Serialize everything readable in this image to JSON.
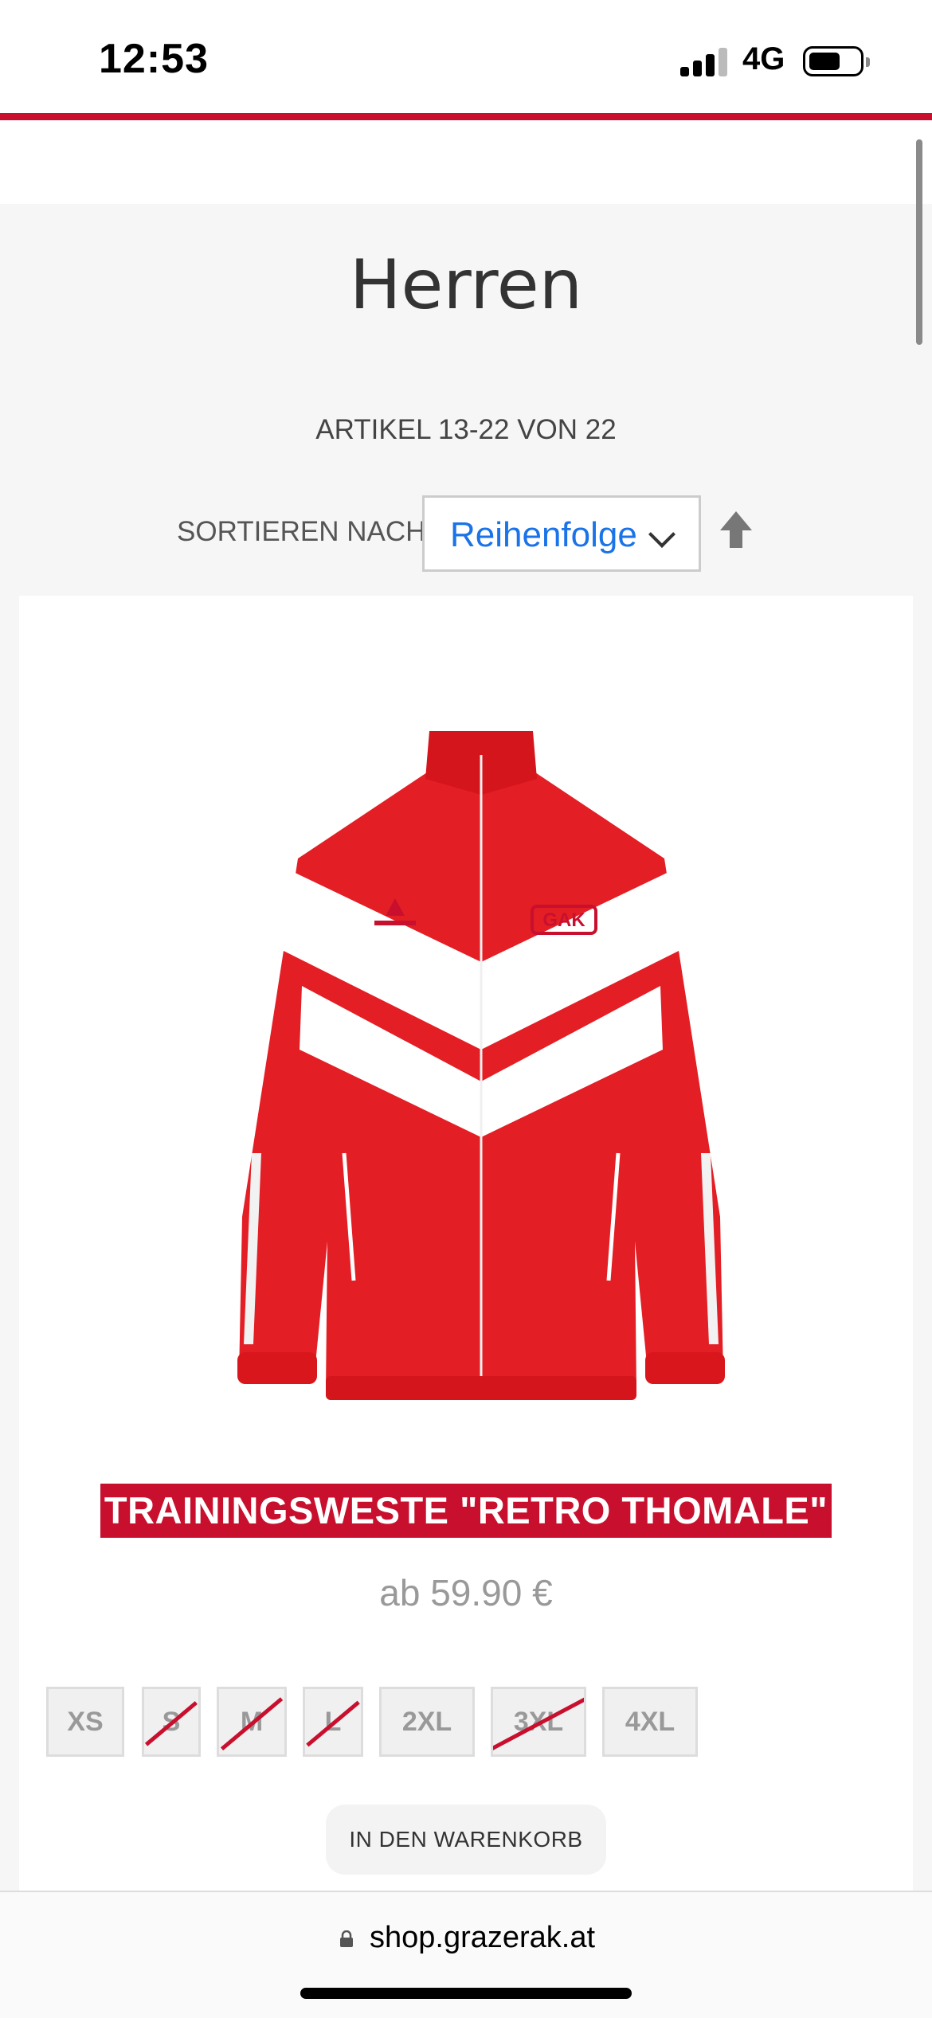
{
  "status": {
    "time": "12:53",
    "network": "4G"
  },
  "category": {
    "title": "Herren",
    "count_text": "ARTIKEL 13-22 VON 22"
  },
  "sort": {
    "label": "SORTIEREN NACH",
    "value": "Reihenfolge",
    "direction_icon": "arrow-up-icon"
  },
  "product": {
    "name": "TRAININGSWESTE \"RETRO THOMALE\"",
    "price": "ab 59.90 €",
    "image": "red-white-track-jacket",
    "sizes": [
      {
        "label": "XS",
        "available": true
      },
      {
        "label": "S",
        "available": false
      },
      {
        "label": "M",
        "available": false
      },
      {
        "label": "L",
        "available": false
      },
      {
        "label": "2XL",
        "available": true
      },
      {
        "label": "3XL",
        "available": false
      },
      {
        "label": "4XL",
        "available": true
      }
    ],
    "cart_label": "IN DEN WARENKORB"
  },
  "browser": {
    "url": "shop.grazerak.at"
  },
  "colors": {
    "brand_red": "#c8102e",
    "link_blue": "#1a73e8"
  }
}
